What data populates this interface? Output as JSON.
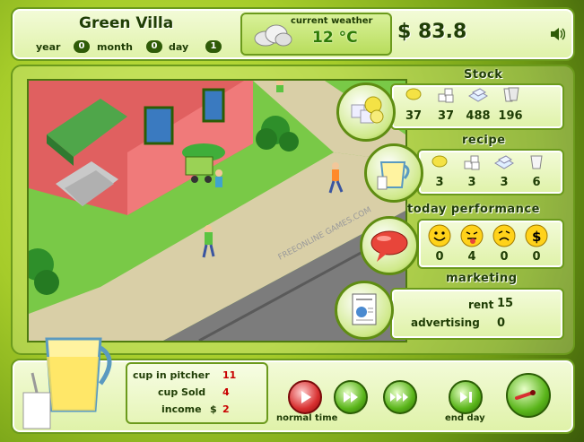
{
  "header": {
    "location": "Green Villa",
    "year_label": "year",
    "year_value": "0",
    "month_label": "month",
    "month_value": "0",
    "day_label": "day",
    "day_value": "1",
    "weather_label": "current weather",
    "weather_value": "12 °C",
    "weather_icon": "cloud-icon",
    "money": "$ 83.8",
    "sound_icon": "speaker-icon"
  },
  "stock": {
    "title": "Stock",
    "items": [
      {
        "icon": "lemon-icon",
        "value": "37"
      },
      {
        "icon": "sugar-icon",
        "value": "37"
      },
      {
        "icon": "ice-icon",
        "value": "488"
      },
      {
        "icon": "cup-icon",
        "value": "196"
      }
    ]
  },
  "recipe": {
    "title": "recipe",
    "items": [
      {
        "icon": "lemon-icon",
        "value": "3"
      },
      {
        "icon": "sugar-icon",
        "value": "3"
      },
      {
        "icon": "ice-icon",
        "value": "3"
      },
      {
        "icon": "cup-icon",
        "value": "6"
      }
    ]
  },
  "performance": {
    "title": "today performance",
    "items": [
      {
        "icon": "happy-face-icon",
        "value": "0"
      },
      {
        "icon": "tongue-face-icon",
        "value": "4"
      },
      {
        "icon": "sour-face-icon",
        "value": "0"
      },
      {
        "icon": "money-face-icon",
        "value": "0"
      }
    ]
  },
  "marketing": {
    "title": "marketing",
    "rent_label": "rent",
    "rent_value": "15",
    "advertising_label": "advertising",
    "advertising_value": "0"
  },
  "bottom": {
    "cup_in_pitcher_label": "cup in pitcher",
    "cup_in_pitcher_value": "11",
    "cup_sold_label": "cup Sold",
    "cup_sold_value": "4",
    "income_label": "income",
    "income_currency": "$",
    "income_value": "2",
    "normal_time_label": "normal time",
    "end_day_label": "end day"
  },
  "colors": {
    "accent": "#6b9a1c",
    "dark_text": "#1f3d05",
    "value_red": "#c80000"
  }
}
